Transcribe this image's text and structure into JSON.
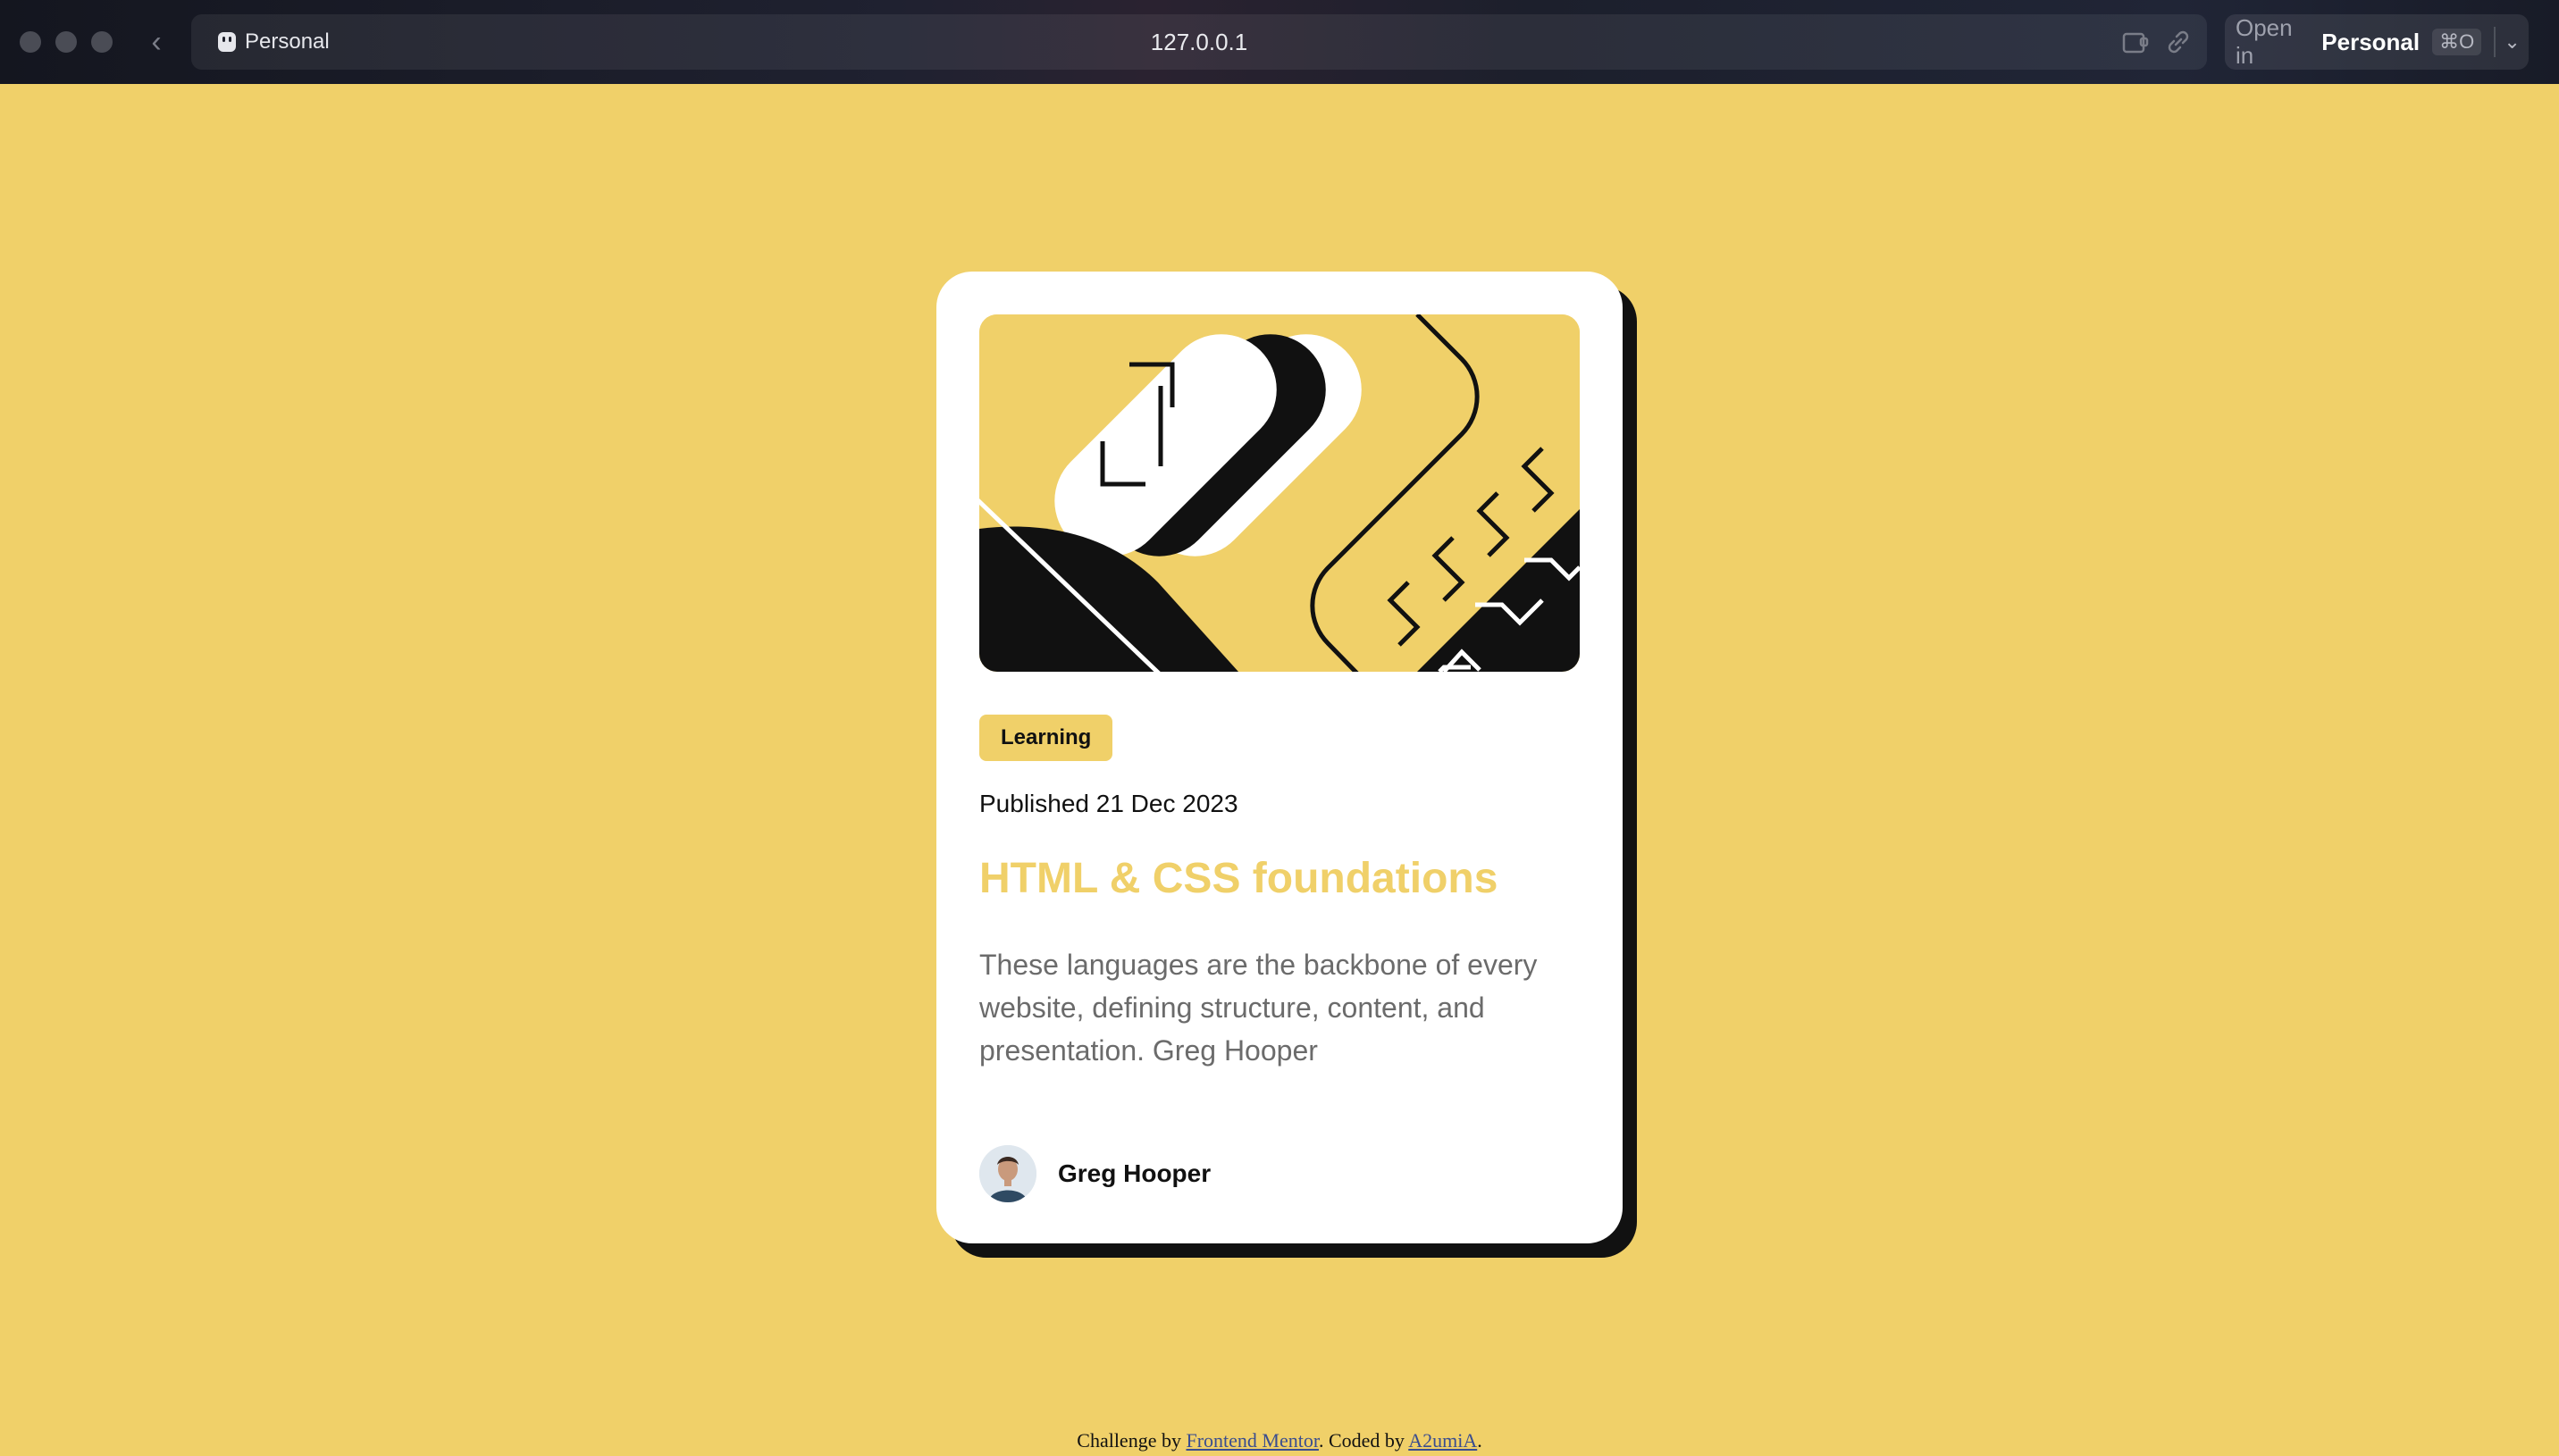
{
  "browser": {
    "profile_label": "Personal",
    "url": "127.0.0.1",
    "open_in": {
      "label": "Open in",
      "profile": "Personal",
      "shortcut": "⌘O"
    }
  },
  "card": {
    "tag": "Learning",
    "published": "Published 21 Dec 2023",
    "title": "HTML & CSS foundations",
    "description": "These languages are the backbone of every website, defining structure, content, and presentation. Greg Hooper",
    "author": {
      "name": "Greg Hooper"
    }
  },
  "footer": {
    "challenge_prefix": "Challenge by",
    "challenge_link": "Frontend Mentor",
    "coded_prefix": ". Coded by",
    "coded_link": "A2umiA",
    "suffix": "."
  },
  "colors": {
    "background": "#f0d069",
    "card": "#ffffff",
    "accent": "#f0d069",
    "ink": "#111111",
    "muted_text": "#6b6b6b"
  }
}
